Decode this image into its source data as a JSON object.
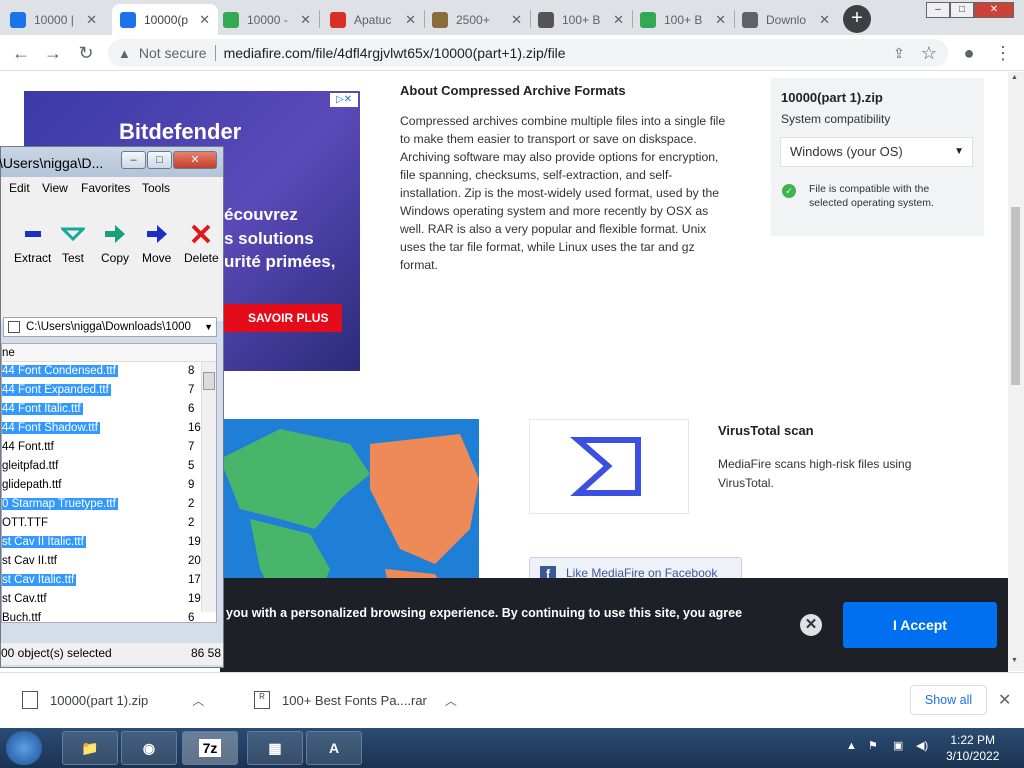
{
  "browser": {
    "tabs": [
      {
        "title": "10000 | ",
        "icon": "globe-icon",
        "color": "#1a73e8"
      },
      {
        "title": "10000(p",
        "icon": "mediafire-icon",
        "color": "#1a73e8"
      },
      {
        "title": "10000 - ",
        "icon": "google-drive-icon",
        "color": "#34a853"
      },
      {
        "title": "Apatuc",
        "icon": "red-circle-icon",
        "color": "#d93025"
      },
      {
        "title": "2500+ ",
        "icon": "app-icon",
        "color": "#8a6d3b"
      },
      {
        "title": "100+ B",
        "icon": "page-icon",
        "color": "#555555"
      },
      {
        "title": "100+ B",
        "icon": "google-drive-icon",
        "color": "#34a853"
      },
      {
        "title": "Downlo",
        "icon": "download-icon",
        "color": "#5f6368"
      }
    ],
    "new_tab": "+",
    "security": "Not secure",
    "url": "mediafire.com/file/4dfl4rgjvlwt65x/10000(part+1).zip/file"
  },
  "ad": {
    "brand": "Bitdefender",
    "lines": [
      "écouvrez",
      "s solutions",
      "urité primées,"
    ],
    "cta": "SAVOIR PLUS"
  },
  "about": {
    "title": "About Compressed Archive Formats",
    "body": "Compressed archives combine multiple files into a single file to make them easier to transport or save on diskspace. Archiving software may also provide options for encryption, file spanning, checksums, self-extraction, and self-installation. Zip is the most-widely used format, used by the Windows operating system and more recently by OSX as well. RAR is also a very popular and flexible format. Unix uses the tar file format, while Linux uses the tar and gz format."
  },
  "file_card": {
    "name": "10000(part 1).zip",
    "compat_label": "System compatibility",
    "os_select": "Windows (your OS)",
    "compat_msg": "File is compatible with the selected operating system."
  },
  "virustotal": {
    "title": "VirusTotal scan",
    "desc": "MediaFire scans high-risk files using VirusTotal."
  },
  "facebook": {
    "label": "Like MediaFire on Facebook"
  },
  "cookie": {
    "text": "you with a personalized browsing experience. By continuing to use this site, you agree",
    "accept": "I Accept"
  },
  "sevenzip": {
    "title": "\\Users\\nigga\\D...",
    "menu": [
      "Edit",
      "View",
      "Favorites",
      "Tools"
    ],
    "toolbar": [
      "Extract",
      "Test",
      "Copy",
      "Move",
      "Delete"
    ],
    "path": "C:\\Users\\nigga\\Downloads\\1000",
    "column_name": "ne",
    "files": [
      {
        "name": "44 Font Condensed.ttf",
        "size": "8",
        "selected": true
      },
      {
        "name": "44 Font Expanded.ttf",
        "size": "7",
        "selected": true
      },
      {
        "name": "44 Font Italic.ttf",
        "size": "6",
        "selected": true
      },
      {
        "name": "44 Font Shadow.ttf",
        "size": "16",
        "selected": true
      },
      {
        "name": "44 Font.ttf",
        "size": "7",
        "selected": false
      },
      {
        "name": "gleitpfad.ttf",
        "size": "5",
        "selected": false
      },
      {
        "name": "glidepath.ttf",
        "size": "9",
        "selected": false
      },
      {
        "name": "0 Starmap Truetype.ttf",
        "size": "2",
        "selected": true
      },
      {
        "name": "OTT.TTF",
        "size": "2",
        "selected": false
      },
      {
        "name": "st Cav II Italic.ttf",
        "size": "19",
        "selected": true
      },
      {
        "name": "st Cav II.ttf",
        "size": "20",
        "selected": false
      },
      {
        "name": "st Cav Italic.ttf",
        "size": "17",
        "selected": true
      },
      {
        "name": "st Cav.ttf",
        "size": "19",
        "selected": false
      },
      {
        "name": "Buch.ttf",
        "size": "6",
        "selected": false
      }
    ],
    "status_left": "00 object(s) selected",
    "status_right": "86 58"
  },
  "downloads": {
    "items": [
      "10000(part 1).zip",
      "100+ Best Fonts Pa....rar"
    ],
    "show_all": "Show all"
  },
  "taskbar": {
    "apps": [
      "explorer-icon",
      "chrome-icon",
      "7z",
      "task-manager-icon",
      "font-app-icon"
    ],
    "time": "1:22 PM",
    "date": "3/10/2022"
  }
}
